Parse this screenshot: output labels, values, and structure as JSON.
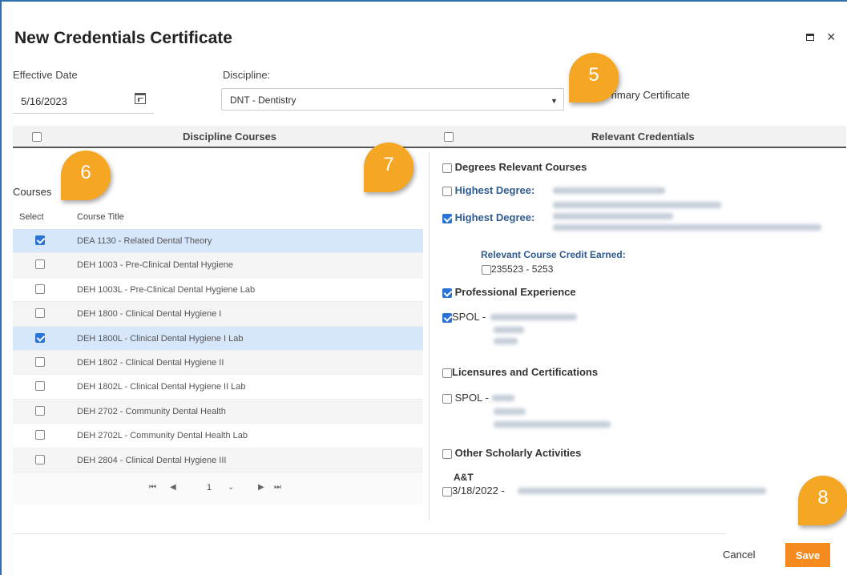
{
  "dialog": {
    "title": "New Credentials Certificate"
  },
  "form": {
    "effective_date_label": "Effective Date",
    "effective_date_value": "5/16/2023",
    "discipline_label": "Discipline:",
    "discipline_value": "DNT - Dentistry",
    "primary_label": "Primary Certificate"
  },
  "left": {
    "header": "Discipline Courses",
    "courses_label": "Courses",
    "col_select": "Select",
    "col_title": "Course Title",
    "rows": [
      {
        "title": "DEA 1130 - Related Dental Theory",
        "checked": true
      },
      {
        "title": "DEH 1003 - Pre-Clinical Dental Hygiene",
        "checked": false
      },
      {
        "title": "DEH 1003L - Pre-Clinical Dental Hygiene Lab",
        "checked": false
      },
      {
        "title": "DEH 1800 - Clinical Dental Hygiene I",
        "checked": false
      },
      {
        "title": "DEH 1800L - Clinical Dental Hygiene I Lab",
        "checked": true
      },
      {
        "title": "DEH 1802 - Clinical Dental Hygiene II",
        "checked": false
      },
      {
        "title": "DEH 1802L - Clinical Dental Hygiene II Lab",
        "checked": false
      },
      {
        "title": "DEH 2702 - Community Dental Health",
        "checked": false
      },
      {
        "title": "DEH 2702L - Community Dental Health Lab",
        "checked": false
      },
      {
        "title": "DEH 2804 - Clinical Dental Hygiene III",
        "checked": false
      }
    ],
    "pager": {
      "first": "⏮",
      "prev": "◀",
      "page": "1",
      "next": "▶",
      "last": "⏭"
    }
  },
  "right": {
    "header": "Relevant Credentials",
    "degrees_relevant": "Degrees Relevant Courses",
    "highest_degree_1": "Highest Degree:",
    "highest_degree_2": "Highest Degree:",
    "relevant_credit": "Relevant Course Credit Earned:",
    "credit_item": "235523 - 5253",
    "professional_experience": "Professional Experience",
    "spol_1": "SPOL -",
    "licensures": "Licensures and Certifications",
    "spol_2": "SPOL -",
    "other_scholarly": "Other Scholarly Activities",
    "at_label": "A&T",
    "at_item": "3/18/2022 -"
  },
  "footer": {
    "cancel": "Cancel",
    "save": "Save"
  },
  "callouts": [
    "5",
    "6",
    "7",
    "8"
  ],
  "colors": {
    "accent": "#f58a1f",
    "callout": "#f5a623",
    "checkbox": "#2a73d6",
    "selected_row": "#d6e6fb"
  }
}
